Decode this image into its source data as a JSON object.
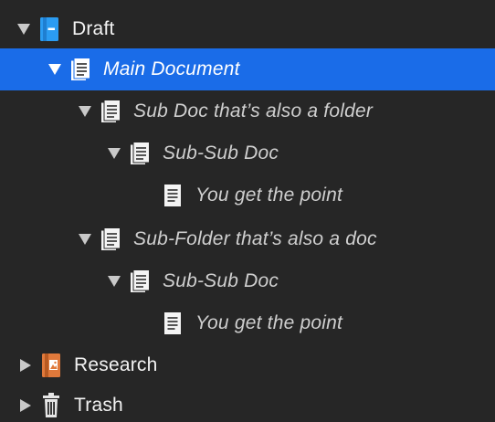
{
  "binder": {
    "items": [
      {
        "label": "Draft",
        "expanded": true,
        "icon": "draft-folder-icon"
      },
      {
        "label": "Main Document",
        "expanded": true,
        "selected": true,
        "icon": "document-stack-icon"
      },
      {
        "label": "Sub Doc that’s also a folder",
        "expanded": true,
        "icon": "document-stack-icon"
      },
      {
        "label": "Sub-Sub Doc",
        "expanded": true,
        "icon": "document-stack-icon"
      },
      {
        "label": "You get the point",
        "icon": "document-icon"
      },
      {
        "label": "Sub-Folder that’s also a doc",
        "expanded": true,
        "icon": "document-stack-icon"
      },
      {
        "label": "Sub-Sub Doc",
        "expanded": true,
        "icon": "document-stack-icon"
      },
      {
        "label": "You get the point",
        "icon": "document-icon"
      },
      {
        "label": "Research",
        "expanded": false,
        "icon": "research-folder-icon"
      },
      {
        "label": "Trash",
        "expanded": false,
        "icon": "trash-icon"
      }
    ]
  },
  "colors": {
    "background": "#262626",
    "selection": "#1a6ce8",
    "draft_icon": "#2b9cf2",
    "research_icon": "#e0793b"
  }
}
